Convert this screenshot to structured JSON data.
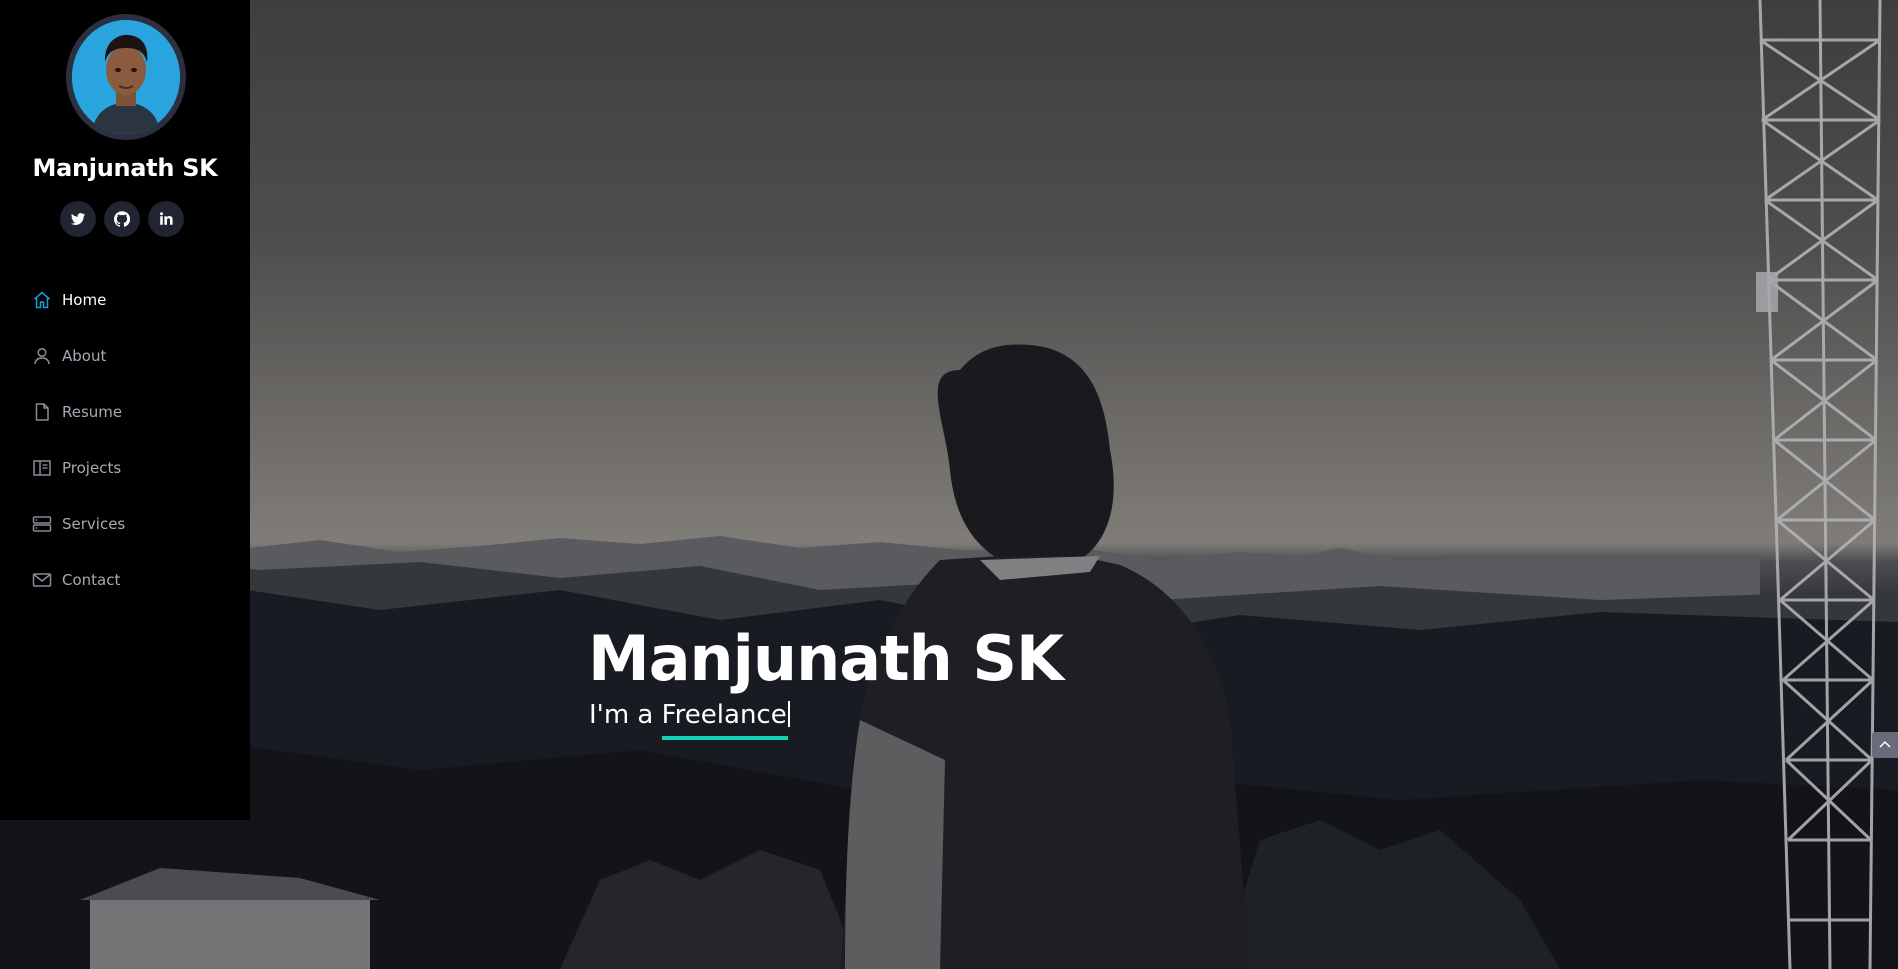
{
  "profile": {
    "name": "Manjunath SK"
  },
  "socials": [
    {
      "icon": "twitter-icon"
    },
    {
      "icon": "github-icon"
    },
    {
      "icon": "linkedin-icon"
    }
  ],
  "nav": {
    "items": [
      {
        "label": "Home",
        "icon": "home-icon",
        "active": true
      },
      {
        "label": "About",
        "icon": "person-icon",
        "active": false
      },
      {
        "label": "Resume",
        "icon": "file-icon",
        "active": false
      },
      {
        "label": "Projects",
        "icon": "book-icon",
        "active": false
      },
      {
        "label": "Services",
        "icon": "server-icon",
        "active": false
      },
      {
        "label": "Contact",
        "icon": "envelope-icon",
        "active": false
      }
    ]
  },
  "hero": {
    "title": "Manjunath SK",
    "subtitle_prefix": "I'm a ",
    "typed_text": "Freelance"
  },
  "colors": {
    "accent": "#149ddd",
    "underline": "#18d0b5",
    "sidebar_bg": "#000000",
    "social_bg": "#212431"
  }
}
